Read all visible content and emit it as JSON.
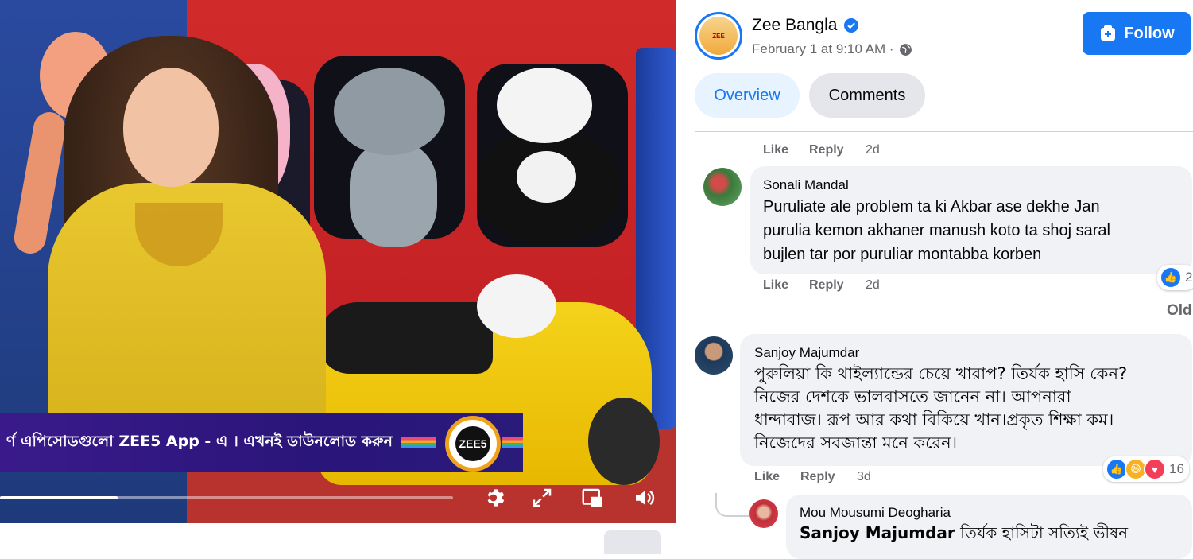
{
  "video": {
    "banner_text": "র্ণ এপিসোডগুলো ZEE5 App - এ । এখনই ডাউনলোড করুন",
    "badge_text": "ZEE5",
    "progress": 0.26
  },
  "post": {
    "page_name": "Zee Bangla",
    "meta_date": "February 1 at 9:10 AM ·",
    "follow_label": "Follow"
  },
  "tabs": {
    "overview": "Overview",
    "comments": "Comments"
  },
  "actions": {
    "like": "Like",
    "reply": "Reply"
  },
  "comments": [
    {
      "time": "2d"
    },
    {
      "author": "Sonali Mandal",
      "text_lines": [
        "Puruliate ale problem ta ki Akbar ase dekhe Jan",
        "purulia kemon akhaner manush koto ta shoj saral",
        "bujlen tar por puruliar montabba korben"
      ],
      "time": "2d",
      "reactions": "2"
    },
    {
      "author": "Sanjoy Majumdar",
      "text_lines": [
        "পুরুলিয়া কি থাইল্যান্ডের চেয়ে খারাপ? তির্যক হাসি কেন?",
        "নিজের দেশকে ভালবাসতে জানেন না। আপনারা",
        "ধান্দাবাজ। রূপ আর কথা বিকিয়ে খান।প্রকৃত শিক্ষা কম।",
        "নিজেদের সবজান্তা মনে করেন।"
      ],
      "time": "3d",
      "reactions": "16"
    },
    {
      "author": "Mou Mousumi Deogharia",
      "mention": "Sanjoy Majumdar",
      "text": " তির্যক হাসিটা সত্যিই ভীষন"
    }
  ],
  "older_label": "Old"
}
